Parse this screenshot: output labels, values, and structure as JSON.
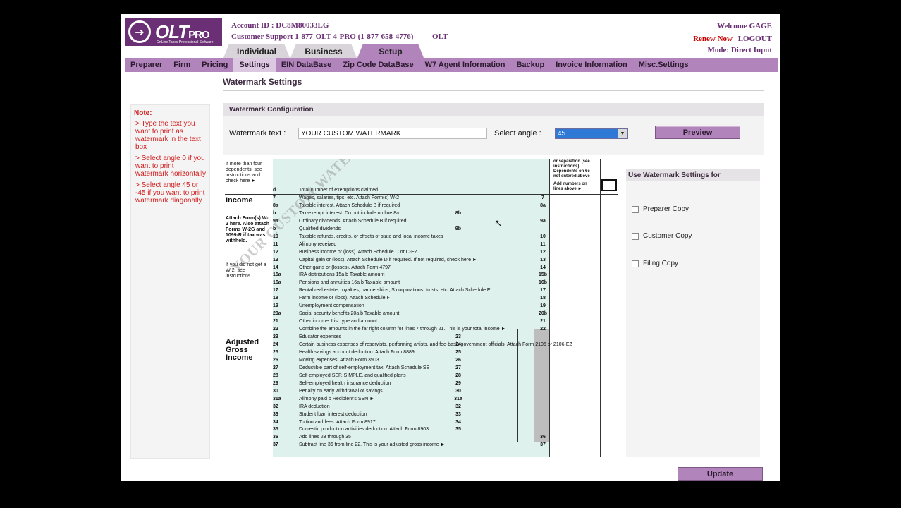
{
  "header": {
    "logo_text": "OLT",
    "logo_suffix": "PRO",
    "logo_subtitle": "OnLine Taxes Professional Software",
    "account": "Account ID : DC8M80033LG",
    "support": "Customer Support 1-877-OLT-4-PRO (1-877-658-4776)",
    "olt": "OLT",
    "welcome": "Welcome GAGE",
    "renew": "Renew Now",
    "logout": "LOGOUT",
    "mode": "Mode: Direct Input"
  },
  "top_tabs": [
    "Individual",
    "Business",
    "Setup"
  ],
  "nav": [
    "Preparer",
    "Firm",
    "Pricing",
    "Settings",
    "EIN DataBase",
    "Zip Code DataBase",
    "W7 Agent Information",
    "Backup",
    "Invoice Information",
    "Misc.Settings"
  ],
  "page_title": "Watermark Settings",
  "note": {
    "title": "Note:",
    "items": [
      "> Type the text you want to print as watermark in the text box",
      "> Select angle 0 if you want to print watermark horizontally",
      "> Select angle 45 or -45 if you want to print watermark diagonally"
    ]
  },
  "config": {
    "title": "Watermark Configuration",
    "text_label": "Watermark text :",
    "text_value": "YOUR CUSTOM WATERMARK",
    "angle_label": "Select angle :",
    "angle_value": "45",
    "preview_label": "Preview"
  },
  "copies": {
    "title": "Use Watermark Settings for",
    "items": [
      "Preparer Copy",
      "Customer Copy",
      "Filing Copy"
    ]
  },
  "update_label": "Update",
  "form": {
    "watermark": "YOUR CUSTOM WATERMARK",
    "top_left": "If more than four dependents, see instructions and check here ►",
    "top_right_1": "or separation (see instructions)",
    "top_right_2": "Dependents on 6c not entered above",
    "top_right_3": "Add numbers on lines above ►",
    "income_title": "Income",
    "agi_title": "Adjusted Gross Income",
    "attach_note": "Attach Form(s) W-2 here. Also attach Forms W-2G and 1099-R if tax was withheld.",
    "w2_note": "If you did not get a W-2, see instructions.",
    "lines": [
      {
        "n": "d",
        "t": "Total number of exemptions claimed",
        "r": ""
      },
      {
        "n": "7",
        "t": "Wages, salaries, tips, etc. Attach Form(s) W-2",
        "r": "7"
      },
      {
        "n": "8a",
        "t": "Taxable interest. Attach Schedule B if required",
        "r": "8a"
      },
      {
        "n": "b",
        "t": "Tax-exempt interest. Do not include on line 8a",
        "r": "",
        "m": "8b"
      },
      {
        "n": "9a",
        "t": "Ordinary dividends. Attach Schedule B if required",
        "r": "9a"
      },
      {
        "n": "b",
        "t": "Qualified dividends",
        "r": "",
        "m": "9b"
      },
      {
        "n": "10",
        "t": "Taxable refunds, credits, or offsets of state and local income taxes",
        "r": "10"
      },
      {
        "n": "11",
        "t": "Alimony received",
        "r": "11"
      },
      {
        "n": "12",
        "t": "Business income or (loss). Attach Schedule C or C-EZ",
        "r": "12"
      },
      {
        "n": "13",
        "t": "Capital gain or (loss). Attach Schedule D if required. If not required, check here ►",
        "r": "13"
      },
      {
        "n": "14",
        "t": "Other gains or (losses). Attach Form 4797",
        "r": "14"
      },
      {
        "n": "15a",
        "t": "IRA distributions      15a                          b  Taxable amount",
        "r": "15b"
      },
      {
        "n": "16a",
        "t": "Pensions and annuities  16a                          b  Taxable amount",
        "r": "16b"
      },
      {
        "n": "17",
        "t": "Rental real estate, royalties, partnerships, S corporations, trusts, etc. Attach Schedule E",
        "r": "17"
      },
      {
        "n": "18",
        "t": "Farm income or (loss). Attach Schedule F",
        "r": "18"
      },
      {
        "n": "19",
        "t": "Unemployment compensation",
        "r": "19"
      },
      {
        "n": "20a",
        "t": "Social security benefits  20a                        b  Taxable amount",
        "r": "20b"
      },
      {
        "n": "21",
        "t": "Other income. List type and amount",
        "r": "21"
      },
      {
        "n": "22",
        "t": "Combine the amounts in the far right column for lines 7 through 21. This is your total income ►",
        "r": "22"
      },
      {
        "n": "23",
        "t": "Educator expenses",
        "r": "",
        "m": "23"
      },
      {
        "n": "24",
        "t": "Certain business expenses of reservists, performing artists, and fee-basis government officials. Attach Form 2106 or 2106-EZ",
        "r": "",
        "m": "24"
      },
      {
        "n": "25",
        "t": "Health savings account deduction. Attach Form 8889",
        "r": "",
        "m": "25"
      },
      {
        "n": "26",
        "t": "Moving expenses. Attach Form 3903",
        "r": "",
        "m": "26"
      },
      {
        "n": "27",
        "t": "Deductible part of self-employment tax. Attach Schedule SE",
        "r": "",
        "m": "27"
      },
      {
        "n": "28",
        "t": "Self-employed SEP, SIMPLE, and qualified plans",
        "r": "",
        "m": "28"
      },
      {
        "n": "29",
        "t": "Self-employed health insurance deduction",
        "r": "",
        "m": "29"
      },
      {
        "n": "30",
        "t": "Penalty on early withdrawal of savings",
        "r": "",
        "m": "30"
      },
      {
        "n": "31a",
        "t": "Alimony paid  b Recipient's SSN ►",
        "r": "",
        "m": "31a"
      },
      {
        "n": "32",
        "t": "IRA deduction",
        "r": "",
        "m": "32"
      },
      {
        "n": "33",
        "t": "Student loan interest deduction",
        "r": "",
        "m": "33"
      },
      {
        "n": "34",
        "t": "Tuition and fees. Attach Form 8917",
        "r": "",
        "m": "34"
      },
      {
        "n": "35",
        "t": "Domestic production activities deduction. Attach Form 8903",
        "r": "",
        "m": "35"
      },
      {
        "n": "36",
        "t": "Add lines 23 through 35",
        "r": "36"
      },
      {
        "n": "37",
        "t": "Subtract line 36 from line 22. This is your adjusted gross income ►",
        "r": "37"
      }
    ]
  }
}
